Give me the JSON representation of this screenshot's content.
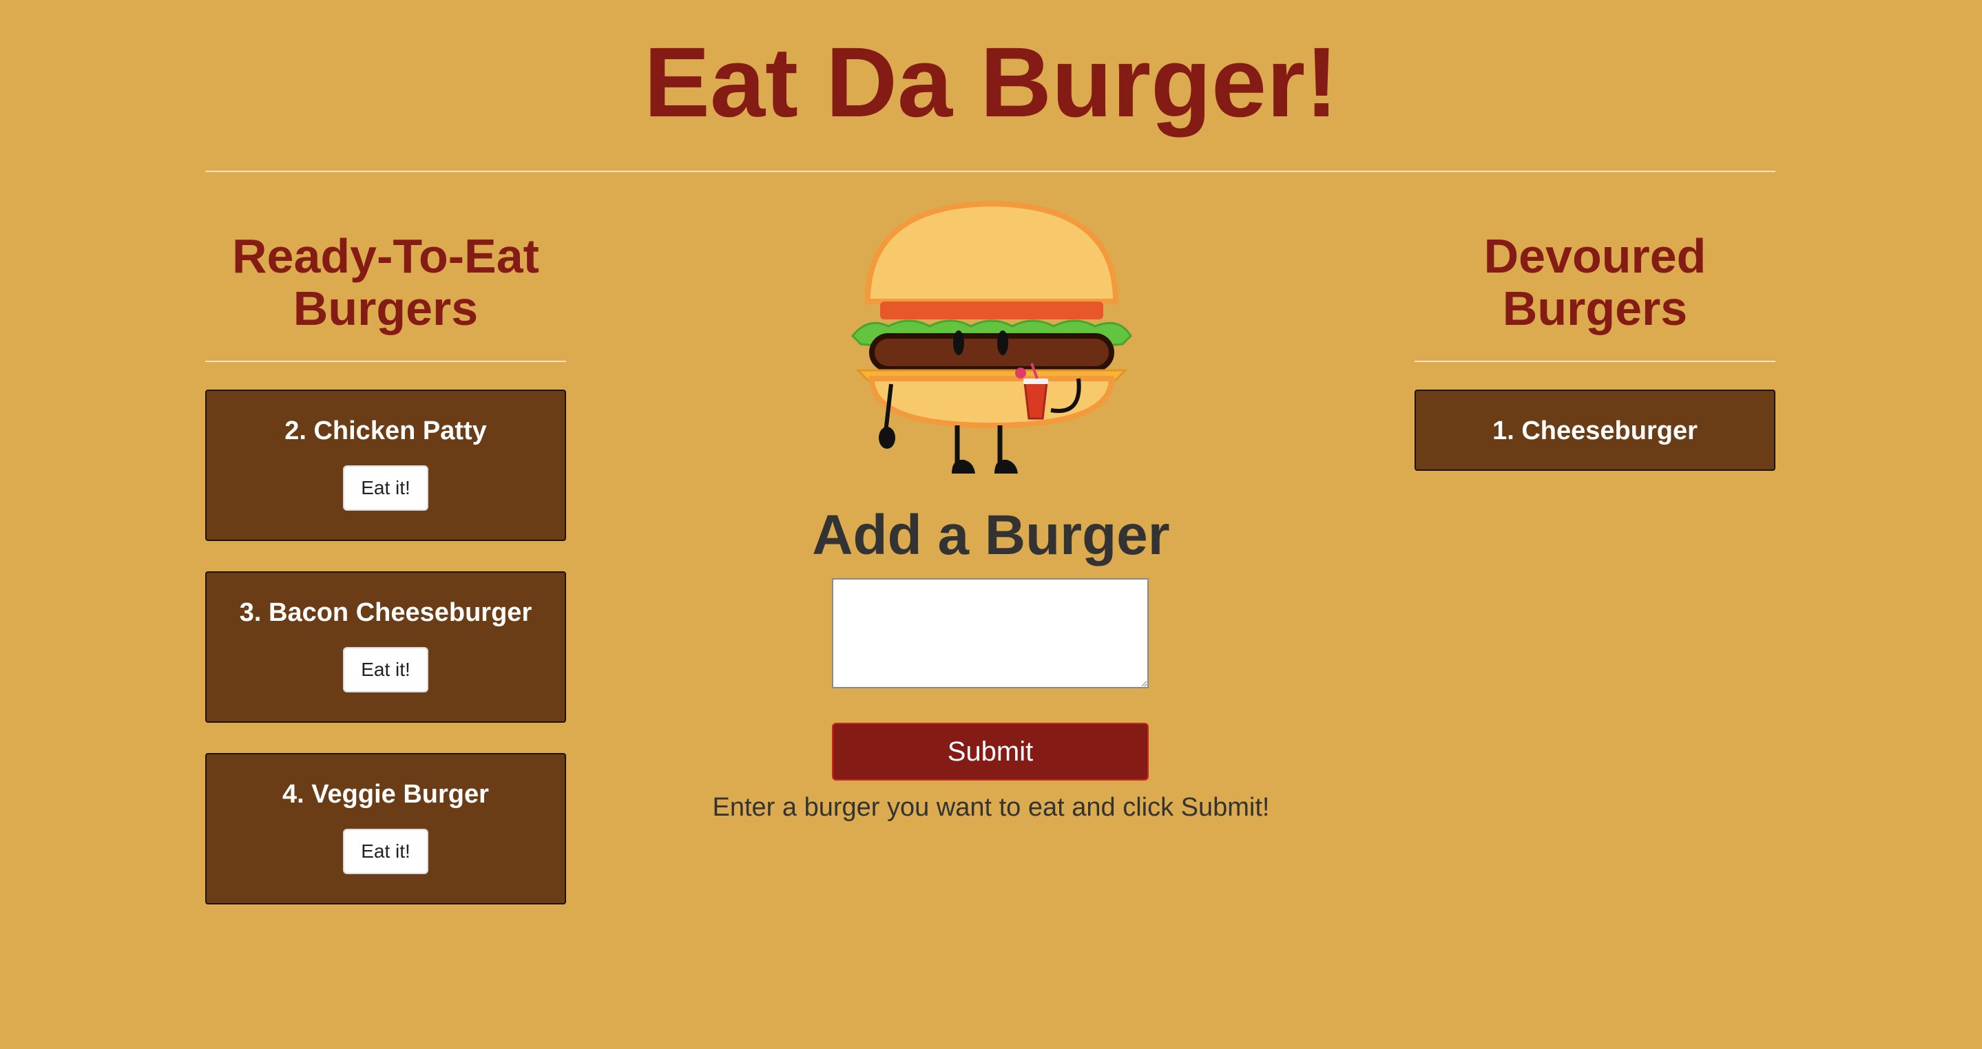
{
  "header": {
    "title": "Eat Da Burger!"
  },
  "ready_column": {
    "heading": "Ready-To-Eat Burgers",
    "items": [
      {
        "label": "2. Chicken Patty",
        "button": "Eat it!"
      },
      {
        "label": "3. Bacon Cheeseburger",
        "button": "Eat it!"
      },
      {
        "label": "4. Veggie Burger",
        "button": "Eat it!"
      }
    ]
  },
  "devoured_column": {
    "heading": "Devoured Burgers",
    "items": [
      {
        "label": "1. Cheeseburger"
      }
    ]
  },
  "add_form": {
    "heading": "Add a Burger",
    "input_value": "",
    "input_placeholder": "",
    "submit_label": "Submit",
    "helper_text": "Enter a burger you want to eat and click Submit!"
  },
  "colors": {
    "background": "#ddab4f",
    "accent": "#841b15",
    "card": "#6a3d16"
  },
  "icons": {
    "mascot": "burger-mascot-icon"
  }
}
